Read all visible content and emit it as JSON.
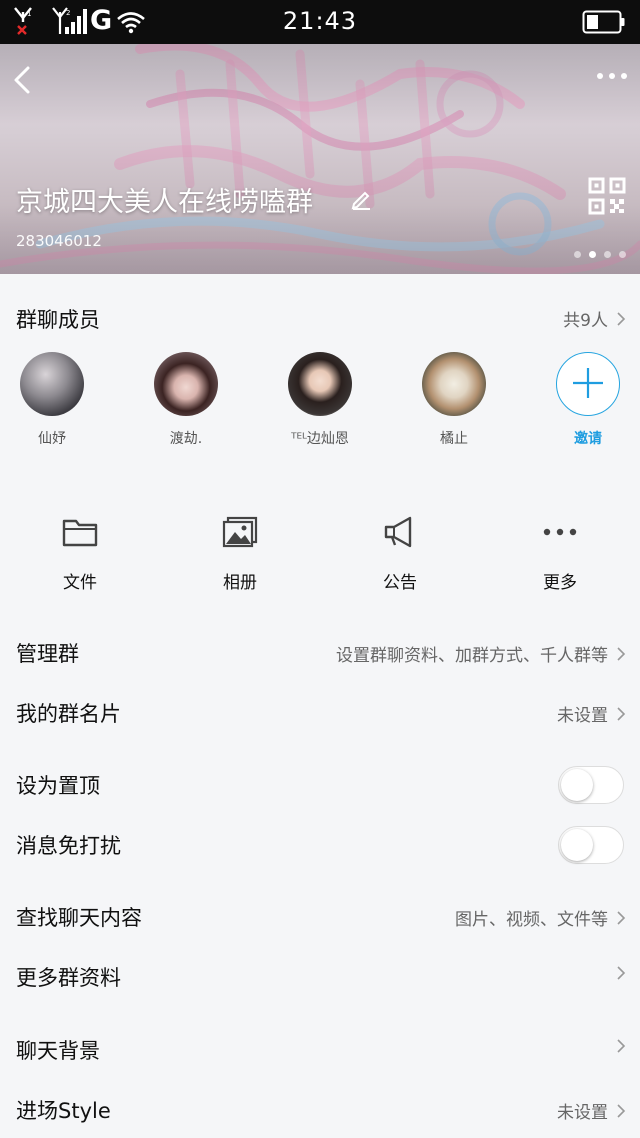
{
  "status_bar": {
    "time": "21:43",
    "network": "G"
  },
  "header": {
    "group_name": "京城四大美人在线唠嗑群",
    "group_id": "283046012"
  },
  "members": {
    "title": "群聊成员",
    "count_label": "共9人",
    "list": [
      {
        "name": "仙妤"
      },
      {
        "name": "渡劫."
      },
      {
        "name": "ᵀᴱᴸ边灿恩"
      },
      {
        "name": "橘止"
      }
    ],
    "invite_label": "邀请"
  },
  "actions": [
    {
      "label": "文件",
      "icon": "folder-icon"
    },
    {
      "label": "相册",
      "icon": "album-icon"
    },
    {
      "label": "公告",
      "icon": "megaphone-icon"
    },
    {
      "label": "更多",
      "icon": "more-dots-icon"
    }
  ],
  "settings": {
    "manage": {
      "label": "管理群",
      "value": "设置群聊资料、加群方式、千人群等"
    },
    "my_card": {
      "label": "我的群名片",
      "value": "未设置"
    },
    "pin_top": {
      "label": "设为置顶",
      "on": false
    },
    "mute": {
      "label": "消息免打扰",
      "on": false
    },
    "search_chat": {
      "label": "查找聊天内容",
      "value": "图片、视频、文件等"
    },
    "more_info": {
      "label": "更多群资料"
    },
    "background": {
      "label": "聊天背景"
    },
    "entrance": {
      "label": "进场Style",
      "value": "未设置"
    }
  },
  "colors": {
    "accent": "#1f9de0",
    "status_bar": "#0d0d0d",
    "page_bg": "#f5f6f8"
  }
}
